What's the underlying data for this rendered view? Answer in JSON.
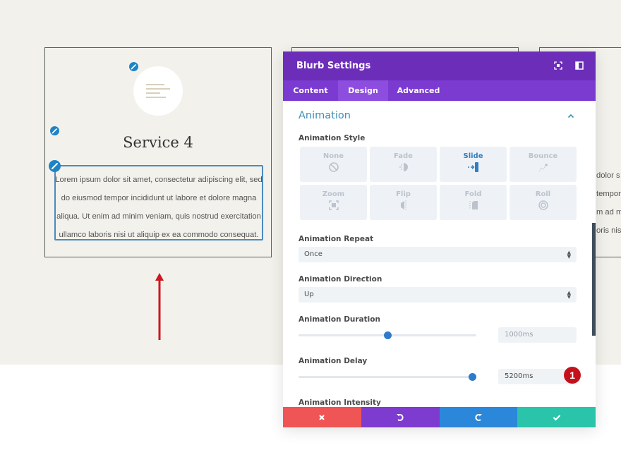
{
  "page": {
    "card": {
      "title": "Service 4",
      "text_lines": [
        "Lorem ipsum dolor sit amet, consectetur adipiscing elit, sed",
        "do eiusmod tempor incididunt ut labore et dolore magna",
        "aliqua. Ut enim ad minim veniam, quis nostrud exercitation",
        "ullamco laboris nisi ut aliquip ex ea commodo consequat."
      ]
    },
    "right_card_partial_lines": [
      "dolor s",
      "tempor",
      "m ad m",
      "oris nisi"
    ]
  },
  "panel": {
    "title": "Blurb Settings",
    "header_icons": [
      "screenshot-expand-icon",
      "sidebar-layout-icon"
    ],
    "tabs": [
      {
        "label": "Content",
        "active": false
      },
      {
        "label": "Design",
        "active": true
      },
      {
        "label": "Advanced",
        "active": false
      }
    ],
    "section": {
      "title": "Animation",
      "expanded": true
    },
    "animation_style": {
      "label": "Animation Style",
      "selected": "Slide",
      "options": [
        {
          "label": "None",
          "icon": "none-icon"
        },
        {
          "label": "Fade",
          "icon": "fade-icon"
        },
        {
          "label": "Slide",
          "icon": "slide-icon"
        },
        {
          "label": "Bounce",
          "icon": "bounce-icon"
        },
        {
          "label": "Zoom",
          "icon": "zoom-icon"
        },
        {
          "label": "Flip",
          "icon": "flip-icon"
        },
        {
          "label": "Fold",
          "icon": "fold-icon"
        },
        {
          "label": "Roll",
          "icon": "roll-icon"
        }
      ]
    },
    "animation_repeat": {
      "label": "Animation Repeat",
      "value": "Once"
    },
    "animation_direction": {
      "label": "Animation Direction",
      "value": "Up"
    },
    "animation_duration": {
      "label": "Animation Duration",
      "value": "1000ms",
      "slider_fraction": 0.5
    },
    "animation_delay": {
      "label": "Animation Delay",
      "value": "5200ms",
      "slider_fraction": 0.98
    },
    "animation_intensity": {
      "label": "Animation Intensity"
    },
    "annotation_badge": "1",
    "footer": {
      "cancel_icon": "close-icon",
      "undo_icon": "undo-icon",
      "redo_icon": "redo-icon",
      "save_icon": "check-icon",
      "colors": {
        "cancel": "#ef5555",
        "undo": "#7e3bd0",
        "redo": "#2b87da",
        "save": "#29c4a9"
      }
    }
  },
  "colors": {
    "header": "#6c2eb9",
    "tabs": "#7b3ad0",
    "accent_blue": "#2e7cc9",
    "section_title": "#3e8fb8",
    "page_bg": "#f2f1ec",
    "annotation_red": "#c4121c"
  }
}
